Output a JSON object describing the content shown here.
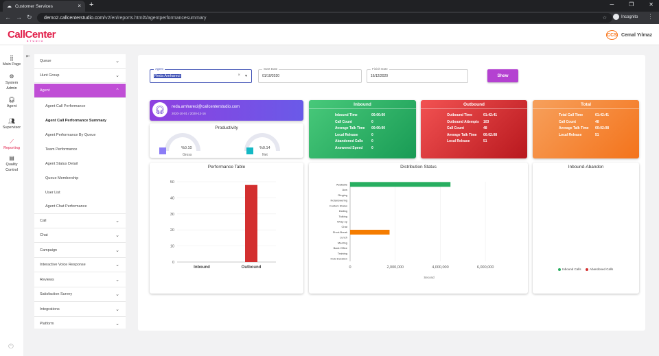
{
  "browser": {
    "tab_title": "Customer Services",
    "url_host": "demo2.callcenterstudio.com",
    "url_path": "/v2/en/reports.html#/agentperformancesummary",
    "incognito_label": "Incognito"
  },
  "header": {
    "logo_main": "CallCenter",
    "logo_sub": "STUDIO",
    "user_badge": "CCS",
    "user_name": "Cemal Yılmaz"
  },
  "iconbar": [
    {
      "label": "Main Page",
      "icon": "grid-icon"
    },
    {
      "label": "System Admin",
      "icon": "gear-icon"
    },
    {
      "label": "Agent",
      "icon": "headset-icon"
    },
    {
      "label": "Supervisor",
      "icon": "people-icon"
    },
    {
      "label": "Reporting",
      "icon": "chart-line-icon"
    },
    {
      "label": "Quality Control",
      "icon": "clipboard-icon"
    }
  ],
  "menu": {
    "top": [
      "Queue",
      "Hunt Group"
    ],
    "active": "Agent",
    "sub": [
      "Agent Call Performance",
      "Agent Call Performance Summary",
      "Agent Performance By Queue",
      "Team Performance",
      "Agent Status Detail",
      "Queue Membership",
      "User List",
      "Agent Chat Performance"
    ],
    "bottom": [
      "Call",
      "Chat",
      "Campaign",
      "Interactive Voice Response",
      "Reviews",
      "Satisfaction Survey",
      "Integrations",
      "Platform"
    ]
  },
  "filters": {
    "agent_label": "Agent",
    "agent_value": "Reda Amhareci",
    "start_label": "Start Date",
    "start_value": "01/10/2020",
    "finish_label": "Finish Date",
    "finish_value": "16/12/2020",
    "show_button": "Show"
  },
  "agent_card": {
    "email": "reda.amhareci@callcenterstudio.com",
    "dates": "2020-10-01  /  2020-12-16"
  },
  "productivity": {
    "title": "Productivity",
    "gross_value": "%0.10",
    "gross_label": "Gross",
    "net_value": "%0.14",
    "net_label": "Net",
    "gross_color": "#8b7cf6",
    "net_color": "#14b8c4"
  },
  "inbound": {
    "title": "Inbound",
    "rows": [
      {
        "label": "Inbound Time",
        "value": "00:00:00"
      },
      {
        "label": "Call Count",
        "value": "0"
      },
      {
        "label": "Average Talk Time",
        "value": "00:00:00"
      },
      {
        "label": "Local Release",
        "value": "0"
      },
      {
        "label": "Abandoned Calls",
        "value": "0"
      },
      {
        "label": "Answered Speed",
        "value": "0"
      }
    ]
  },
  "outbound": {
    "title": "Outbound",
    "rows": [
      {
        "label": "Outbound Time",
        "value": "01:42:41"
      },
      {
        "label": "Outbound Attempts",
        "value": "103"
      },
      {
        "label": "Call Count",
        "value": "48"
      },
      {
        "label": "Average Talk Time",
        "value": "00:02:08"
      },
      {
        "label": "Local Release",
        "value": "51"
      }
    ]
  },
  "total": {
    "title": "Total",
    "rows": [
      {
        "label": "Total Call Time",
        "value": "01:42:41"
      },
      {
        "label": "Call Count",
        "value": "48"
      },
      {
        "label": "Average Talk Time",
        "value": "00:02:08"
      },
      {
        "label": "Local Release",
        "value": "51"
      }
    ]
  },
  "chart_data": [
    {
      "type": "bar",
      "title": "Performance Table",
      "categories": [
        "Inbound",
        "Outbound"
      ],
      "values": [
        0,
        48
      ],
      "ylim": [
        0,
        50
      ],
      "yticks": [
        "0",
        "10",
        "20",
        "30",
        "40",
        "50"
      ],
      "color": "#d32f2f"
    },
    {
      "type": "bar",
      "orientation": "horizontal",
      "title": "Distribution Status",
      "categories": [
        "Available",
        "Acw",
        "Ringing",
        "Notanswering",
        "Custom Status",
        "Dialing",
        "Talking",
        "Wrap up",
        "Chat",
        "Short-Break",
        "Lunch",
        "Meeting",
        "Back Office",
        "Training",
        "Hold Duration"
      ],
      "values": [
        4450000,
        0,
        0,
        0,
        0,
        0,
        0,
        0,
        0,
        1750000,
        0,
        0,
        0,
        0,
        0
      ],
      "colors": {
        "Available": "#27ae60",
        "Short-Break": "#f57c00"
      },
      "xlim": [
        0,
        7000000
      ],
      "xticks": [
        "0",
        "2,000,000",
        "4,000,000",
        "6,000,000"
      ],
      "xlabel": "Second"
    },
    {
      "type": "pie",
      "title": "Inbound-Abandon",
      "legend": [
        {
          "name": "Inbound Calls",
          "color": "#27ae60"
        },
        {
          "name": "Abandoned Calls",
          "color": "#d32f2f"
        }
      ]
    }
  ]
}
